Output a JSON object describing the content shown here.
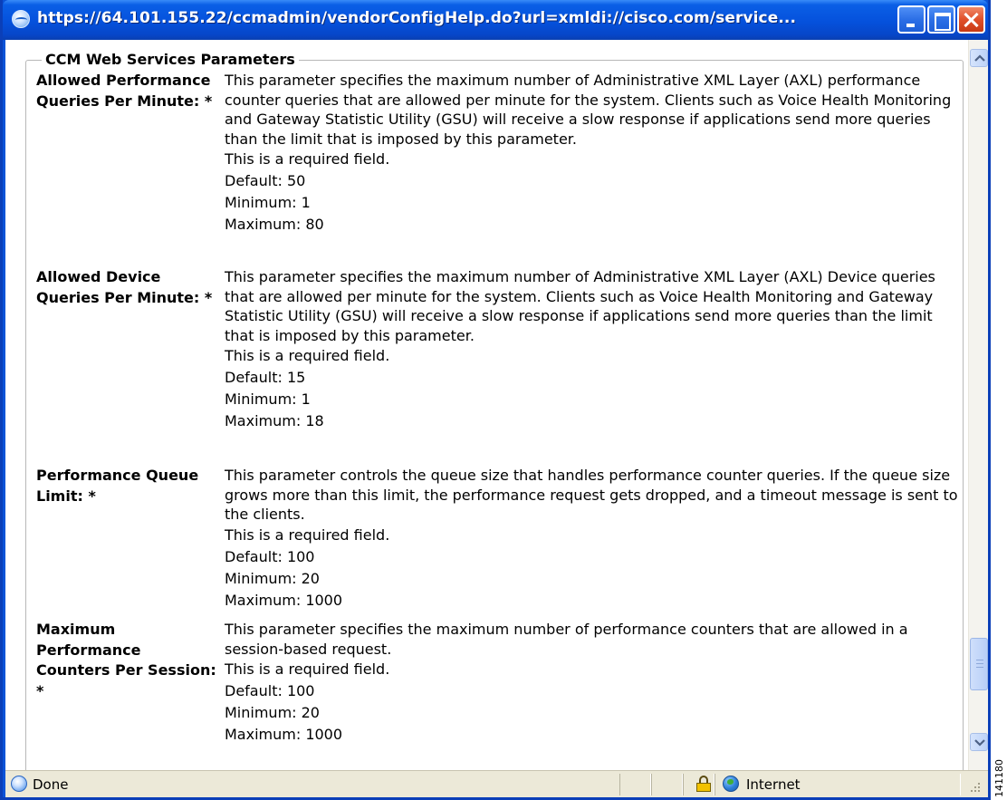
{
  "window": {
    "title": "https://64.101.155.22/ccmadmin/vendorConfigHelp.do?url=xmldi://cisco.com/service...",
    "icon": "ie-page-icon"
  },
  "fieldset": {
    "legend": "CCM Web Services Parameters"
  },
  "parameters": [
    {
      "label": "Allowed Performance Queries Per Minute: *",
      "description": "This parameter specifies the maximum number of Administrative XML Layer (AXL) performance counter queries that are allowed per minute for the system. Clients such as Voice Health Monitoring and Gateway Statistic Utility (GSU) will receive a slow response if applications send more queries than the limit that is imposed by this parameter.",
      "required": "This is a required field.",
      "default": "Default:  50",
      "minimum": "Minimum:  1",
      "maximum": "Maximum:  80"
    },
    {
      "label": "Allowed Device Queries Per Minute: *",
      "description": "This parameter specifies the maximum number of Administrative XML Layer (AXL) Device queries that are allowed per minute for the system. Clients such as Voice Health Monitoring and Gateway Statistic Utility (GSU) will receive a slow response if applications send more queries than the limit that is imposed by this parameter.",
      "required": "This is a required field.",
      "default": "Default:  15",
      "minimum": "Minimum:  1",
      "maximum": "Maximum:  18"
    },
    {
      "label": "Performance Queue Limit: *",
      "description": "This parameter controls the queue size that handles performance counter queries. If the queue size grows more than this limit, the performance request gets dropped, and a timeout message is sent to the clients.",
      "required": "This is a required field.",
      "default": "Default:  100",
      "minimum": "Minimum:  20",
      "maximum": "Maximum:  1000"
    },
    {
      "label": "Maximum Performance Counters Per Session: *",
      "description": "This parameter specifies the maximum number of performance counters that are allowed in a session-based request.",
      "required": "This is a required field.",
      "default": "Default:  100",
      "minimum": "Minimum:  20",
      "maximum": "Maximum:  1000"
    }
  ],
  "statusbar": {
    "status": "Done",
    "zone": "Internet"
  },
  "figure_id": "141180",
  "colors": {
    "titlebar": "#0551dc",
    "frame": "#0b3fb8",
    "statusbar": "#ece9d8",
    "close_button": "#e0502a"
  }
}
